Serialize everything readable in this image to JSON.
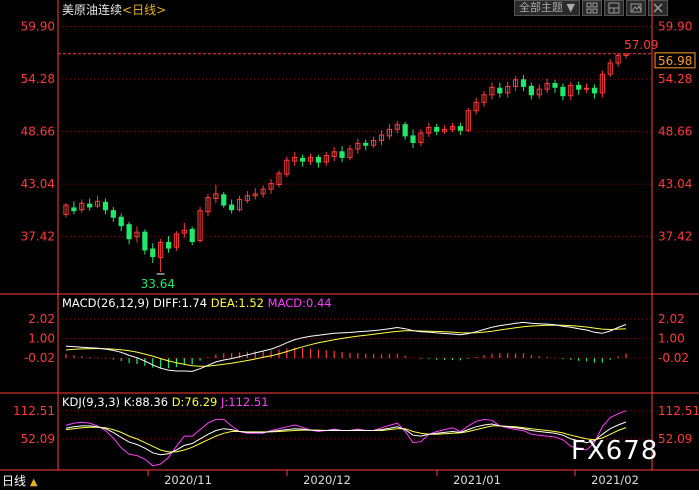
{
  "header": {
    "instrument": "美原油连续",
    "period_tag": "<日线>",
    "theme_button": "全部主题",
    "theme_arrow": "▼",
    "icons": [
      "grid-icon",
      "layout-icon",
      "image-icon",
      "close-icon"
    ]
  },
  "chart_data": [
    {
      "type": "candlestick",
      "title": "美原油连续",
      "yticks": [
        "59.90",
        "54.28",
        "48.66",
        "43.04",
        "37.42"
      ],
      "ylim": [
        31.5,
        60.6
      ],
      "high_marker": "57.09",
      "low_marker": "33.64",
      "current_price": "56.98",
      "candles": [
        [
          39.8,
          40.8,
          39.5,
          41.0
        ],
        [
          40.5,
          40.2,
          39.8,
          41.2
        ],
        [
          40.3,
          41.0,
          40.0,
          41.4
        ],
        [
          40.9,
          40.6,
          40.2,
          41.5
        ],
        [
          40.7,
          41.2,
          40.5,
          41.8
        ],
        [
          41.1,
          40.3,
          39.8,
          41.5
        ],
        [
          40.2,
          39.5,
          39.0,
          40.6
        ],
        [
          39.5,
          38.6,
          38.0,
          39.9
        ],
        [
          38.7,
          37.2,
          36.6,
          39.0
        ],
        [
          37.4,
          37.9,
          36.8,
          38.5
        ],
        [
          37.9,
          36.0,
          35.5,
          38.2
        ],
        [
          36.1,
          35.3,
          34.6,
          36.7
        ],
        [
          35.2,
          36.8,
          33.64,
          37.2
        ],
        [
          36.8,
          36.2,
          35.7,
          37.5
        ],
        [
          36.3,
          37.7,
          35.9,
          38.0
        ],
        [
          37.8,
          38.1,
          37.3,
          38.9
        ],
        [
          38.2,
          36.9,
          36.5,
          38.5
        ],
        [
          37.0,
          40.2,
          36.8,
          40.6
        ],
        [
          40.1,
          41.6,
          39.6,
          42.0
        ],
        [
          41.5,
          42.0,
          41.0,
          43.0
        ],
        [
          41.9,
          40.8,
          40.5,
          42.2
        ],
        [
          40.8,
          40.3,
          39.9,
          41.4
        ],
        [
          40.3,
          41.4,
          40.1,
          41.8
        ],
        [
          41.3,
          41.8,
          41.0,
          42.3
        ],
        [
          41.8,
          42.0,
          41.4,
          42.6
        ],
        [
          42.0,
          42.5,
          41.6,
          42.9
        ],
        [
          42.5,
          43.1,
          42.0,
          43.6
        ],
        [
          43.0,
          44.2,
          42.7,
          44.5
        ],
        [
          44.1,
          45.6,
          43.8,
          46.0
        ],
        [
          45.5,
          45.9,
          45.0,
          46.5
        ],
        [
          45.8,
          45.5,
          44.9,
          46.2
        ],
        [
          45.5,
          45.9,
          45.1,
          46.3
        ],
        [
          45.9,
          45.4,
          44.8,
          46.2
        ],
        [
          45.4,
          46.1,
          45.0,
          46.5
        ],
        [
          46.0,
          46.5,
          45.5,
          47.0
        ],
        [
          46.5,
          45.9,
          45.4,
          47.1
        ],
        [
          45.9,
          46.8,
          45.6,
          47.2
        ],
        [
          46.8,
          47.4,
          46.3,
          47.9
        ],
        [
          47.4,
          47.2,
          46.7,
          47.8
        ],
        [
          47.2,
          47.7,
          46.9,
          48.1
        ],
        [
          47.7,
          48.3,
          47.2,
          48.8
        ],
        [
          48.2,
          48.9,
          47.8,
          49.5
        ],
        [
          48.9,
          49.4,
          48.5,
          49.8
        ],
        [
          49.4,
          48.2,
          47.8,
          49.7
        ],
        [
          48.2,
          47.5,
          46.9,
          48.9
        ],
        [
          47.5,
          48.5,
          47.1,
          48.9
        ],
        [
          48.5,
          49.1,
          48.1,
          49.6
        ],
        [
          49.1,
          48.7,
          48.3,
          49.5
        ],
        [
          48.7,
          48.9,
          48.4,
          49.3
        ],
        [
          48.9,
          49.2,
          48.6,
          49.6
        ],
        [
          49.2,
          48.8,
          48.3,
          49.6
        ],
        [
          48.8,
          50.9,
          48.6,
          51.2
        ],
        [
          50.9,
          51.8,
          50.5,
          52.3
        ],
        [
          51.8,
          52.6,
          51.3,
          53.0
        ],
        [
          52.6,
          53.4,
          52.1,
          53.9
        ],
        [
          53.3,
          52.8,
          52.3,
          53.9
        ],
        [
          52.8,
          53.5,
          52.3,
          54.0
        ],
        [
          53.5,
          54.2,
          53.0,
          54.6
        ],
        [
          54.2,
          53.5,
          53.0,
          54.7
        ],
        [
          53.5,
          52.6,
          52.1,
          53.9
        ],
        [
          52.6,
          53.2,
          52.2,
          53.7
        ],
        [
          53.2,
          53.8,
          52.8,
          54.3
        ],
        [
          53.8,
          53.4,
          52.8,
          54.2
        ],
        [
          53.4,
          52.5,
          52.0,
          53.8
        ],
        [
          52.5,
          53.6,
          52.0,
          54.0
        ],
        [
          53.6,
          53.2,
          52.6,
          54.0
        ],
        [
          53.2,
          53.3,
          52.8,
          53.8
        ],
        [
          53.3,
          52.8,
          52.2,
          53.7
        ],
        [
          52.8,
          54.8,
          52.3,
          55.2
        ],
        [
          54.8,
          56.0,
          54.5,
          56.4
        ],
        [
          56.0,
          56.8,
          55.6,
          57.09
        ],
        [
          56.8,
          56.98,
          56.5,
          57.0
        ]
      ]
    },
    {
      "type": "macd",
      "params": "MACD(26,12,9)",
      "diff": "DIFF:1.74",
      "dea": "DEA:1.52",
      "macd": "MACD:0.44",
      "yticks": [
        "2.02",
        "1.00",
        "-0.02"
      ],
      "ylim": [
        -1.8,
        2.5
      ],
      "diff_values": [
        0.6,
        0.58,
        0.55,
        0.52,
        0.5,
        0.45,
        0.38,
        0.28,
        0.12,
        0.0,
        -0.18,
        -0.38,
        -0.55,
        -0.65,
        -0.7,
        -0.7,
        -0.72,
        -0.58,
        -0.4,
        -0.22,
        -0.12,
        -0.05,
        0.05,
        0.15,
        0.25,
        0.35,
        0.45,
        0.6,
        0.78,
        0.95,
        1.05,
        1.12,
        1.18,
        1.23,
        1.28,
        1.3,
        1.32,
        1.36,
        1.39,
        1.42,
        1.46,
        1.52,
        1.58,
        1.52,
        1.42,
        1.36,
        1.34,
        1.3,
        1.27,
        1.24,
        1.2,
        1.26,
        1.36,
        1.48,
        1.6,
        1.68,
        1.74,
        1.8,
        1.85,
        1.8,
        1.78,
        1.76,
        1.73,
        1.65,
        1.6,
        1.52,
        1.45,
        1.33,
        1.28,
        1.4,
        1.58,
        1.74
      ],
      "dea_values": [
        0.4,
        0.44,
        0.46,
        0.47,
        0.48,
        0.47,
        0.45,
        0.42,
        0.36,
        0.29,
        0.19,
        0.08,
        -0.05,
        -0.17,
        -0.27,
        -0.35,
        -0.42,
        -0.45,
        -0.44,
        -0.4,
        -0.35,
        -0.29,
        -0.22,
        -0.15,
        -0.07,
        0.02,
        0.1,
        0.2,
        0.32,
        0.45,
        0.57,
        0.68,
        0.78,
        0.86,
        0.94,
        1.01,
        1.07,
        1.13,
        1.18,
        1.23,
        1.28,
        1.33,
        1.38,
        1.41,
        1.41,
        1.4,
        1.39,
        1.38,
        1.36,
        1.34,
        1.31,
        1.3,
        1.31,
        1.34,
        1.39,
        1.45,
        1.51,
        1.57,
        1.62,
        1.66,
        1.68,
        1.7,
        1.71,
        1.7,
        1.68,
        1.65,
        1.61,
        1.55,
        1.5,
        1.48,
        1.5,
        1.52
      ],
      "hist_values": [
        0.4,
        0.28,
        0.18,
        0.1,
        0.04,
        -0.04,
        -0.14,
        -0.28,
        -0.48,
        -0.58,
        -0.74,
        -0.92,
        -1.0,
        -0.96,
        -0.86,
        -0.7,
        -0.6,
        -0.26,
        0.08,
        0.36,
        0.46,
        0.48,
        0.54,
        0.6,
        0.64,
        0.66,
        0.7,
        0.8,
        0.92,
        1.0,
        0.96,
        0.88,
        0.8,
        0.74,
        0.68,
        0.58,
        0.5,
        0.46,
        0.42,
        0.38,
        0.36,
        0.38,
        0.4,
        0.22,
        0.02,
        -0.08,
        -0.1,
        -0.16,
        -0.18,
        -0.2,
        -0.22,
        -0.08,
        0.1,
        0.28,
        0.42,
        0.46,
        0.46,
        0.46,
        0.46,
        0.28,
        0.2,
        0.12,
        0.04,
        -0.1,
        -0.16,
        -0.26,
        -0.32,
        -0.44,
        -0.44,
        -0.16,
        0.16,
        0.44
      ]
    },
    {
      "type": "kdj",
      "params": "KDJ(9,3,3)",
      "k": "K:88.36",
      "d": "D:76.29",
      "j": "J:112.51",
      "yticks": [
        "112.51",
        "52.09"
      ],
      "ylim": [
        -15,
        125
      ],
      "k_values": [
        75,
        78,
        80,
        80,
        78,
        74,
        66,
        55,
        45,
        40,
        32,
        22,
        18,
        20,
        28,
        38,
        42,
        52,
        62,
        70,
        74,
        72,
        68,
        66,
        66,
        66,
        68,
        70,
        72,
        74,
        73,
        71,
        70,
        70,
        71,
        70,
        70,
        71,
        70,
        70,
        72,
        75,
        78,
        72,
        60,
        58,
        62,
        64,
        66,
        68,
        66,
        72,
        78,
        82,
        84,
        80,
        78,
        76,
        74,
        70,
        68,
        66,
        64,
        60,
        52,
        48,
        44,
        48,
        62,
        74,
        82,
        88.36
      ],
      "d_values": [
        72,
        74,
        76,
        77,
        77,
        76,
        72,
        66,
        58,
        52,
        44,
        36,
        28,
        24,
        24,
        28,
        34,
        42,
        50,
        58,
        64,
        68,
        68,
        67,
        67,
        67,
        67,
        68,
        69,
        70,
        71,
        71,
        71,
        70,
        70,
        70,
        70,
        70,
        70,
        70,
        70,
        72,
        74,
        74,
        68,
        64,
        62,
        62,
        63,
        64,
        65,
        68,
        72,
        76,
        80,
        80,
        79,
        78,
        76,
        74,
        72,
        70,
        68,
        65,
        60,
        56,
        52,
        50,
        54,
        62,
        70,
        76.29
      ],
      "j_values": [
        81,
        86,
        88,
        86,
        80,
        70,
        54,
        33,
        19,
        16,
        8,
        -6,
        -2,
        12,
        36,
        58,
        58,
        72,
        86,
        94,
        94,
        80,
        68,
        64,
        64,
        64,
        70,
        74,
        78,
        82,
        77,
        71,
        68,
        70,
        73,
        70,
        70,
        73,
        70,
        70,
        76,
        81,
        86,
        68,
        44,
        46,
        62,
        68,
        72,
        76,
        68,
        80,
        90,
        94,
        92,
        80,
        76,
        72,
        70,
        62,
        60,
        58,
        56,
        50,
        36,
        32,
        28,
        44,
        78,
        98,
        106,
        112.51
      ]
    }
  ],
  "footer": {
    "period": "日线",
    "arrow": "▲",
    "dates": [
      "2020/11",
      "2020/12",
      "2021/01",
      "2021/02"
    ]
  },
  "watermark": "FX678",
  "colors": {
    "up": "#ff3a3a",
    "down": "#21e86b",
    "axis": "#ff3a3a",
    "grid": "#7a1a1a",
    "diff": "#ffffff",
    "dea": "#ffff40",
    "macd": "#ff40ff",
    "k": "#ffffff",
    "d": "#ffff40",
    "j": "#ff40ff",
    "label": "#e6b422"
  }
}
